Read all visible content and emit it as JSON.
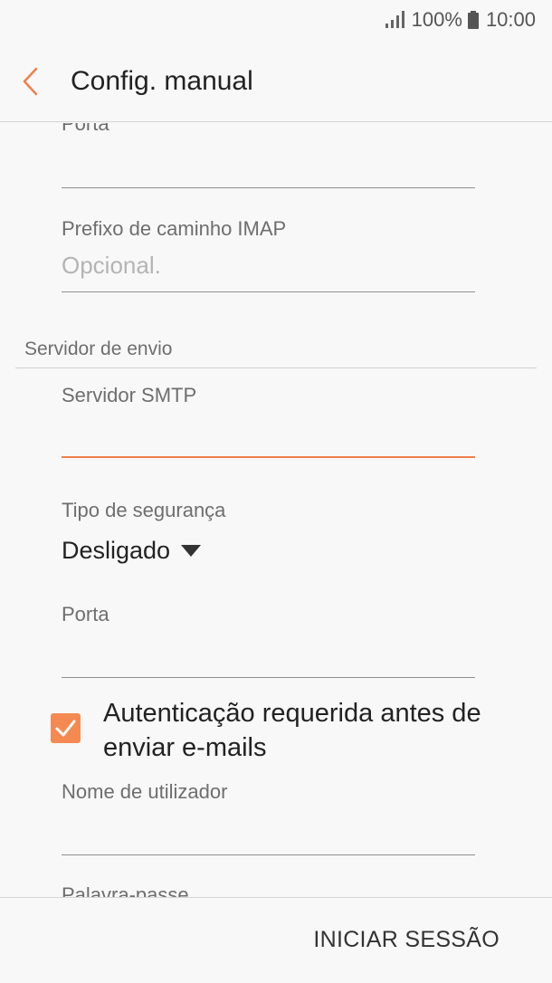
{
  "status_bar": {
    "battery": "100%",
    "time": "10:00"
  },
  "app_bar": {
    "title": "Config. manual"
  },
  "incoming": {
    "port_label": "Porta",
    "imap_prefix_label": "Prefixo de caminho IMAP",
    "imap_prefix_placeholder": "Opcional."
  },
  "outgoing": {
    "section_label": "Servidor de envio",
    "smtp_label": "Servidor SMTP",
    "security_label": "Tipo de segurança",
    "security_value": "Desligado",
    "port_label": "Porta",
    "auth_checkbox_label": "Autenticação requerida antes de enviar e-mails",
    "auth_checked": true,
    "username_label": "Nome de utilizador",
    "password_label": "Palavra-passe"
  },
  "footer": {
    "login_button": "INICIAR SESSÃO"
  },
  "colors": {
    "accent": "#f07f4b",
    "checkbox": "#f48a52"
  }
}
